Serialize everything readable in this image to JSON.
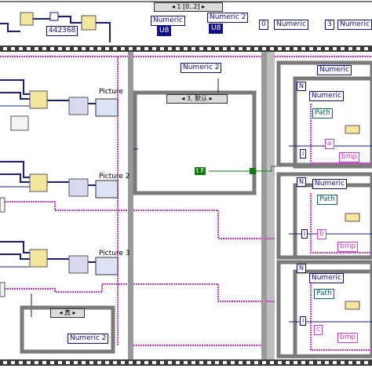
{
  "top_strip": {
    "numeric_a": "442368",
    "selector": "◂ 1 [0..2] ▸",
    "numeric_1": "Numeric",
    "numeric_1_type": "U8",
    "numeric_2": "Numeric 2",
    "numeric_2_type": "U8",
    "const_0": "0",
    "numeric_right_1": "Numeric",
    "const_3": "3",
    "numeric_right_2": "Numeric"
  },
  "left_column": {
    "picture_1": "Picture",
    "picture_2": "Picture 2",
    "picture_3": "Picture 3",
    "case_selector": "◂ 真 ▸",
    "numeric_2": "Numeric 2"
  },
  "middle_column": {
    "numeric_2": "Numeric 2",
    "case_selector": "◂ 3, 默认 ▸",
    "const_t": "t F"
  },
  "right_column": {
    "numeric_top": "Numeric",
    "frame_1": {
      "n": "N",
      "numeric": "Numeric",
      "path": "Path",
      "i": "i",
      "letter": "a",
      "ext": "bmp"
    },
    "frame_2": {
      "n": "N",
      "numeric": "Numeric",
      "path": "Path",
      "i": "i",
      "letter": "b",
      "ext": "bmp"
    },
    "frame_3": {
      "n": "N",
      "numeric": "Numeric",
      "path": "Path",
      "i": "i",
      "letter": "c",
      "ext": "bmp"
    }
  },
  "colors": {
    "numeric_wire": "#1b1b8c",
    "string_wire": "#d23ad2",
    "boolean_wire": "#0f7a0f",
    "structure_gray": "#7a7a7a",
    "frame_film": "#2a2a2a"
  }
}
